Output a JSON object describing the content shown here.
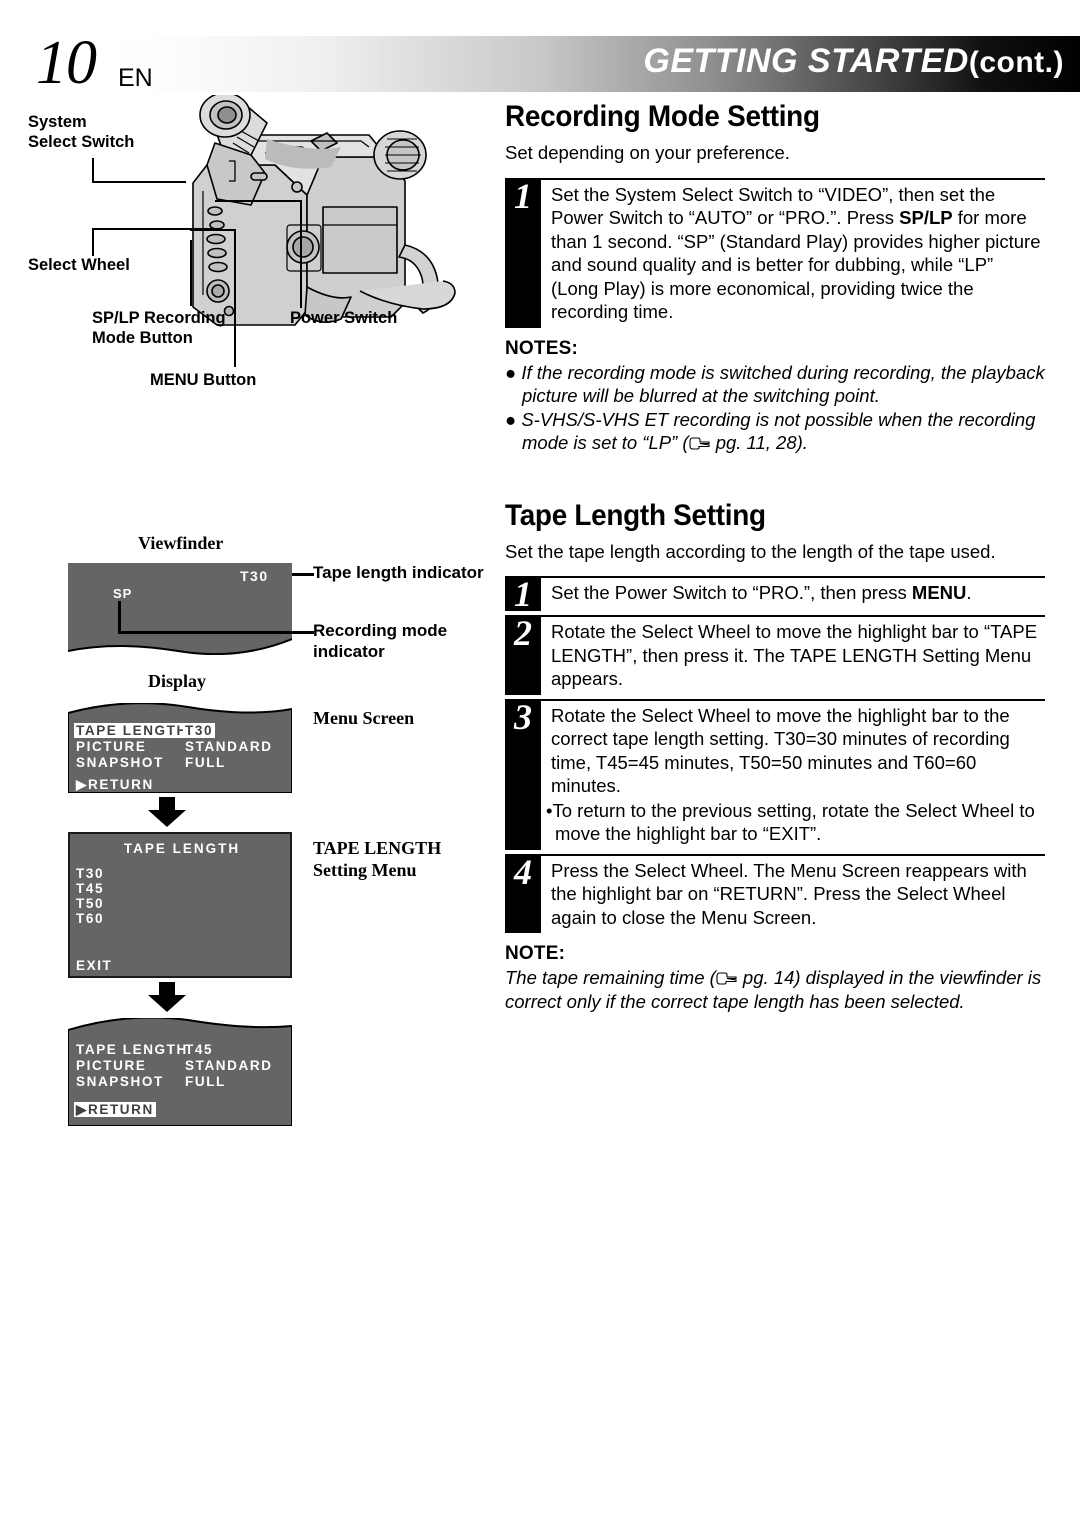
{
  "header": {
    "page_number": "10",
    "language": "EN",
    "title": "GETTING STARTED",
    "title_cont": "(cont.)"
  },
  "diagram": {
    "callouts": [
      {
        "id": "system-select-switch",
        "label": "System\nSelect Switch"
      },
      {
        "id": "select-wheel",
        "label": "Select Wheel"
      },
      {
        "id": "sp-lp-button",
        "label": "SP/LP Recording\nMode Button"
      },
      {
        "id": "power-switch",
        "label": "Power Switch"
      },
      {
        "id": "menu-button",
        "label": "MENU Button"
      }
    ],
    "viewfinder": {
      "label": "Viewfinder",
      "tape_length_value": "T30",
      "recording_mode_value": "SP",
      "tape_length_indicator_label": "Tape length indicator",
      "recording_mode_indicator_label": "Recording mode\nindicator"
    },
    "display": {
      "label": "Display",
      "menu_screen_label": "Menu Screen",
      "setting_menu_label": "TAPE LENGTH\nSetting Menu"
    },
    "menu_screen_1": {
      "rows": [
        {
          "name": "TAPE LENGTH",
          "value": "T30",
          "name_highlighted": true,
          "value_highlighted": true
        },
        {
          "name": "PICTURE",
          "value": "STANDARD",
          "name_highlighted": false,
          "value_highlighted": false
        },
        {
          "name": "SNAPSHOT",
          "value": "FULL",
          "name_highlighted": false,
          "value_highlighted": false
        }
      ],
      "return_label": "RETURN",
      "return_highlighted": false
    },
    "tape_length_menu": {
      "title": "TAPE LENGTH",
      "options": [
        "T30",
        "T45",
        "T50",
        "T60"
      ],
      "exit_label": "EXIT"
    },
    "menu_screen_2": {
      "rows": [
        {
          "name": "TAPE LENGTH",
          "value": "T45",
          "name_highlighted": false,
          "value_highlighted": false
        },
        {
          "name": "PICTURE",
          "value": "STANDARD",
          "name_highlighted": false,
          "value_highlighted": false
        },
        {
          "name": "SNAPSHOT",
          "value": "FULL",
          "name_highlighted": false,
          "value_highlighted": false
        }
      ],
      "return_label": "RETURN",
      "return_highlighted": true
    }
  },
  "recording_mode_section": {
    "title": "Recording Mode Setting",
    "intro": "Set depending on your preference.",
    "step1_num": "1",
    "step1_text_a": "Set the System Select Switch to “VIDEO”, then set the Power Switch to “AUTO” or “PRO.”. Press ",
    "step1_bold": "SP/LP",
    "step1_text_b": " for more than 1 second. “SP” (Standard Play) provides higher picture and sound quality and is better for dubbing, while “LP” (Long Play) is more economical, providing twice the recording time.",
    "notes_heading": "NOTES:",
    "note1": "If the recording mode is switched during recording, the playback picture will be blurred at the switching point.",
    "note2_a": "S-VHS/S-VHS ET recording is not possible when the recording mode is set to “LP” (",
    "note2_b": " pg. 11, 28)."
  },
  "tape_length_section": {
    "title": "Tape Length Setting",
    "intro": "Set the tape length according to the length of the tape used.",
    "step1_num": "1",
    "step1_text_a": "Set the Power Switch to “PRO.”, then press ",
    "step1_bold": "MENU",
    "step1_text_b": ".",
    "step2_num": "2",
    "step2_text": "Rotate the Select Wheel to move the highlight bar to “TAPE LENGTH”, then press it. The TAPE LENGTH Setting Menu appears.",
    "step3_num": "3",
    "step3_text": "Rotate the Select Wheel to move the highlight bar to the correct tape length setting. T30=30 minutes of recording time, T45=45 minutes, T50=50 minutes and T60=60 minutes.",
    "step3_sub": "•To return to the previous setting, rotate the Select Wheel to move the highlight bar to “EXIT”.",
    "step4_num": "4",
    "step4_text": "Press the Select Wheel. The Menu Screen reappears with the highlight bar on “RETURN”. Press the Select Wheel again to close the Menu Screen.",
    "note_heading": "NOTE:",
    "note_a": "The tape remaining time (",
    "note_b": " pg. 14) displayed in the viewfinder is correct only if the correct tape length has been selected."
  }
}
